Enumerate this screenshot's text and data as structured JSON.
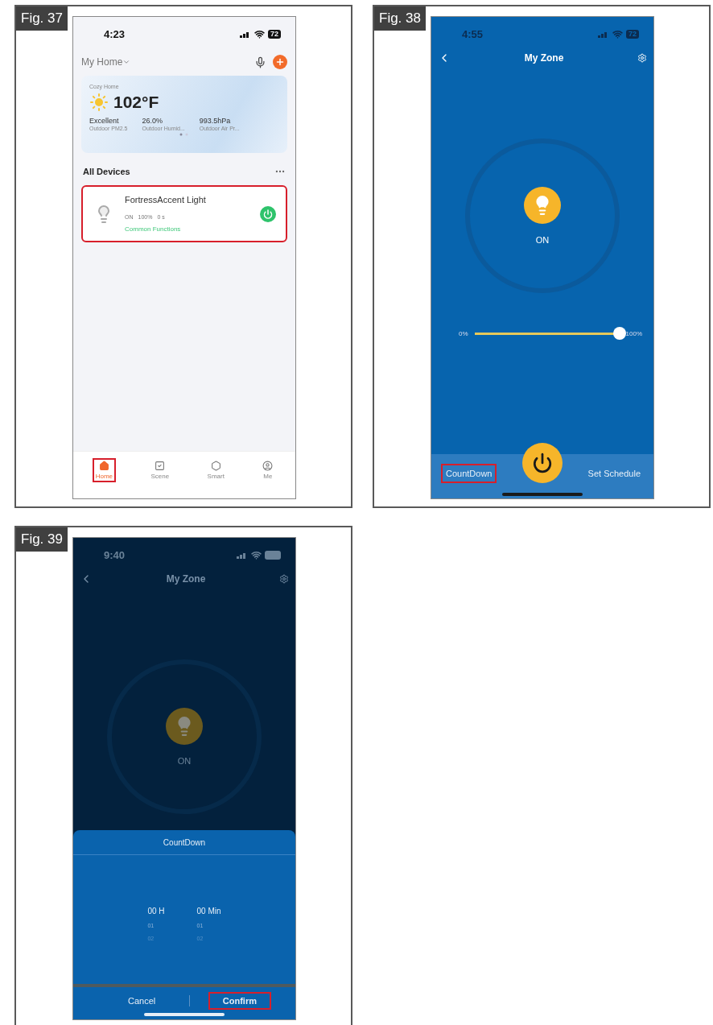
{
  "figures": [
    {
      "label": "Fig. 37",
      "kind": "home",
      "status": {
        "time": "4:23",
        "battery": "72"
      },
      "home_selector": "My Home",
      "weather": {
        "location": "Cozy Home",
        "temperature": "102°F",
        "stats": [
          {
            "value": "Excellent",
            "label": "Outdoor PM2.5"
          },
          {
            "value": "26.0%",
            "label": "Outdoor Humid..."
          },
          {
            "value": "993.5hPa",
            "label": "Outdoor Air Pr..."
          }
        ]
      },
      "section_title": "All Devices",
      "device": {
        "name": "FortressAccent Light",
        "status": [
          "ON",
          "100%",
          "0 s"
        ],
        "link": "Common Functions",
        "on": true,
        "highlighted": true
      },
      "nav": [
        {
          "label": "Home",
          "selected": true,
          "highlighted": true
        },
        {
          "label": "Scene",
          "selected": false,
          "highlighted": false
        },
        {
          "label": "Smart",
          "selected": false,
          "highlighted": false
        },
        {
          "label": "Me",
          "selected": false,
          "highlighted": false
        }
      ]
    },
    {
      "label": "Fig. 38",
      "kind": "control",
      "status": {
        "time": "4:55",
        "battery": "72"
      },
      "title": "My Zone",
      "state": "ON",
      "slider": {
        "min": "0%",
        "max": "100%",
        "level": 1
      },
      "actions": [
        {
          "label": "CountDown",
          "highlighted": true
        },
        {
          "label": "Set Schedule",
          "highlighted": false
        }
      ]
    },
    {
      "label": "Fig. 39",
      "kind": "countdown",
      "status": {
        "time": "9:40"
      },
      "title": "My Zone",
      "state": "ON",
      "sheet": {
        "title": "CountDown",
        "columns": [
          {
            "selected": "00 H",
            "options": [
              "01",
              "02"
            ]
          },
          {
            "selected": "00 Min",
            "options": [
              "01",
              "02"
            ]
          }
        ],
        "buttons": [
          {
            "kind": "cancel",
            "label": "Cancel",
            "highlighted": false
          },
          {
            "kind": "confirm",
            "label": "Confirm",
            "highlighted": true
          }
        ]
      }
    }
  ]
}
